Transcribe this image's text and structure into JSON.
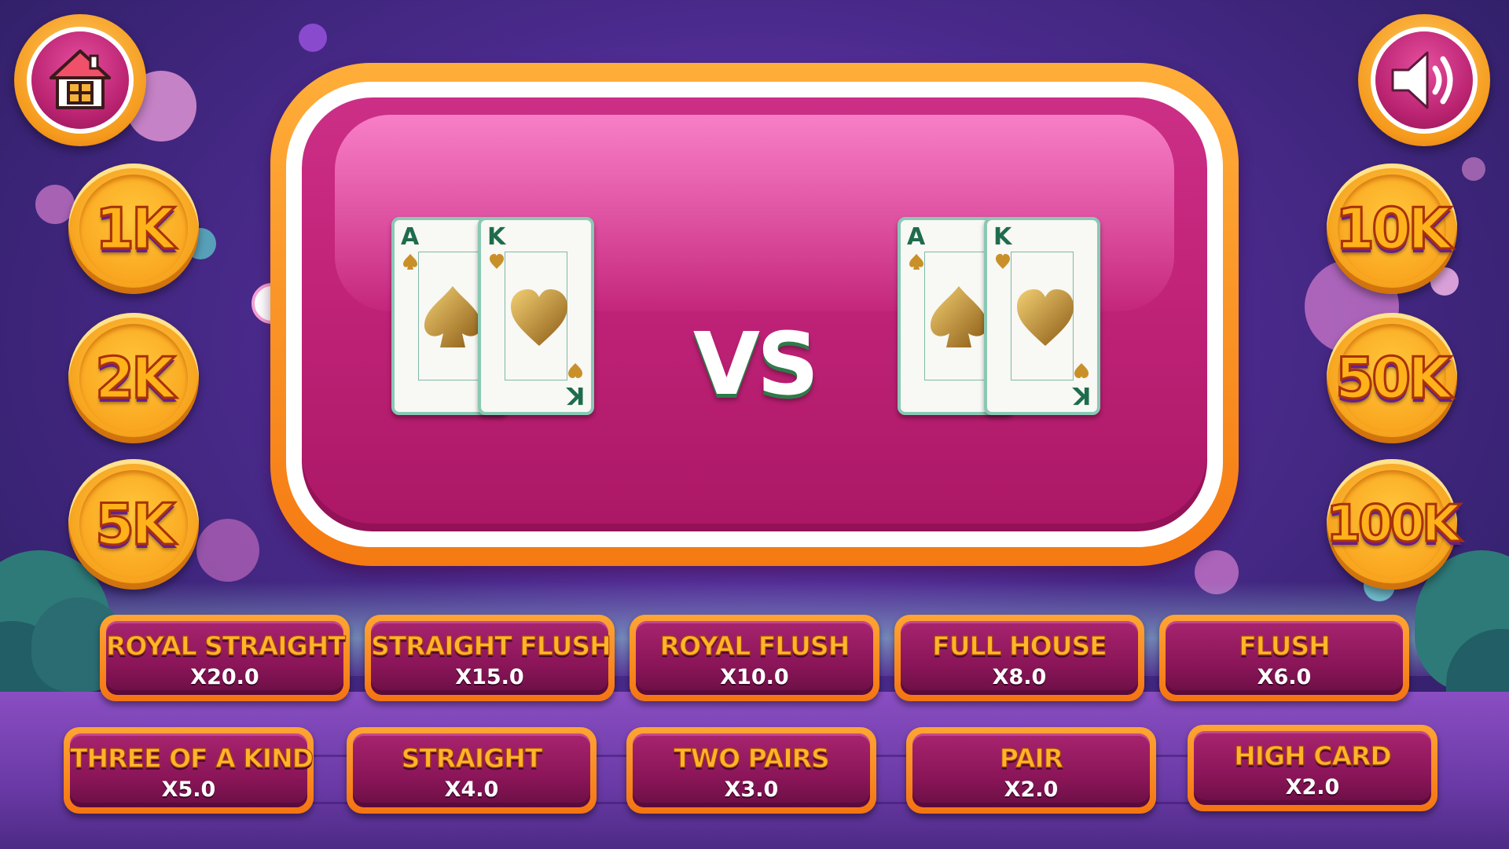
{
  "controls": {
    "home_icon": "house-icon",
    "sound_icon": "speaker-volume-icon"
  },
  "chips": {
    "left": [
      {
        "label": "1K"
      },
      {
        "label": "2K"
      },
      {
        "label": "5K"
      }
    ],
    "right": [
      {
        "label": "10K"
      },
      {
        "label": "50K"
      },
      {
        "label": "100K"
      }
    ]
  },
  "board": {
    "vs_label": "VS",
    "left_hand": [
      {
        "rank": "A",
        "suit": "spade"
      },
      {
        "rank": "K",
        "suit": "heart"
      }
    ],
    "right_hand": [
      {
        "rank": "A",
        "suit": "spade"
      },
      {
        "rank": "K",
        "suit": "heart"
      }
    ]
  },
  "hand_rankings": {
    "row1": [
      {
        "name": "ROYAL STRAIGHT",
        "multiplier": "X20.0"
      },
      {
        "name": "STRAIGHT FLUSH",
        "multiplier": "X15.0"
      },
      {
        "name": "ROYAL FLUSH",
        "multiplier": "X10.0"
      },
      {
        "name": "FULL HOUSE",
        "multiplier": "X8.0"
      },
      {
        "name": "FLUSH",
        "multiplier": "X6.0"
      }
    ],
    "row2": [
      {
        "name": "THREE OF A KIND",
        "multiplier": "X5.0"
      },
      {
        "name": "STRAIGHT",
        "multiplier": "X4.0"
      },
      {
        "name": "TWO PAIRS",
        "multiplier": "X3.0"
      },
      {
        "name": "PAIR",
        "multiplier": "X2.0"
      },
      {
        "name": "HIGH CARD",
        "multiplier": "X2.0"
      }
    ]
  },
  "colors": {
    "board_pink": "#c2247a",
    "board_rim": "#f57a12",
    "chip_gold": "#ffb21a",
    "plate_purple": "#8a1558",
    "card_green": "#1f6c4c"
  }
}
